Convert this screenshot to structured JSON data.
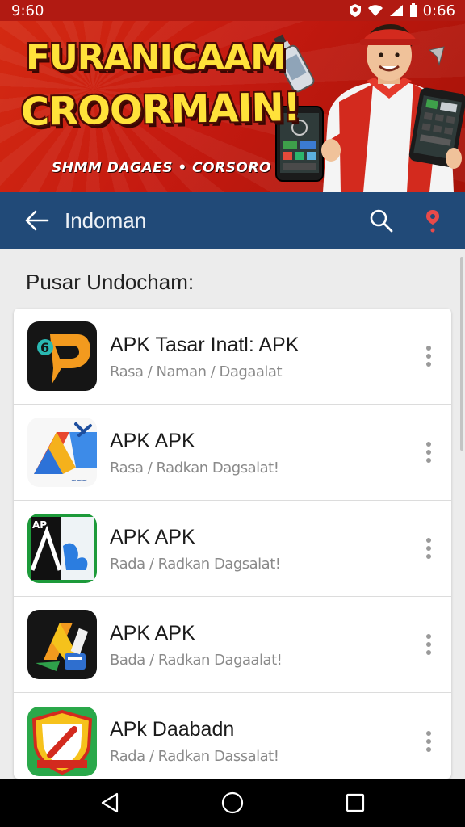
{
  "status_bar": {
    "time": "9:60",
    "battery_time": "0:66"
  },
  "banner": {
    "title_line1": "FURANICAAM",
    "title_line2": "CROORMAIN!",
    "subtitle": "SHMM DAGAES • CORSORO"
  },
  "app_bar": {
    "title": "Indoman"
  },
  "section": {
    "title": "Pusar Undocham:"
  },
  "apps": [
    {
      "name": "APK Tasar Inatl: APK",
      "subtitle": "Rasa / Naman / Dagaalat"
    },
    {
      "name": "APK APK",
      "subtitle": "Rasa / Radkan Dagsalat!"
    },
    {
      "name": "APK APK",
      "subtitle": "Rada / Radkan Dagsalat!"
    },
    {
      "name": "APK APK",
      "subtitle": "Bada / Radkan Dagaalat!"
    },
    {
      "name": "APk Daabadn",
      "subtitle": "Rada / Radkan Dassalat!"
    }
  ],
  "icons": {
    "back": "arrow-left-icon",
    "search": "search-icon",
    "location": "map-pin-icon",
    "more": "more-vertical-icon",
    "nav_back": "triangle-back-icon",
    "nav_home": "circle-home-icon",
    "nav_recent": "square-recent-icon"
  },
  "colors": {
    "app_bar": "#214a78",
    "banner": "#c51a10",
    "accent_pin": "#e84a4a"
  }
}
